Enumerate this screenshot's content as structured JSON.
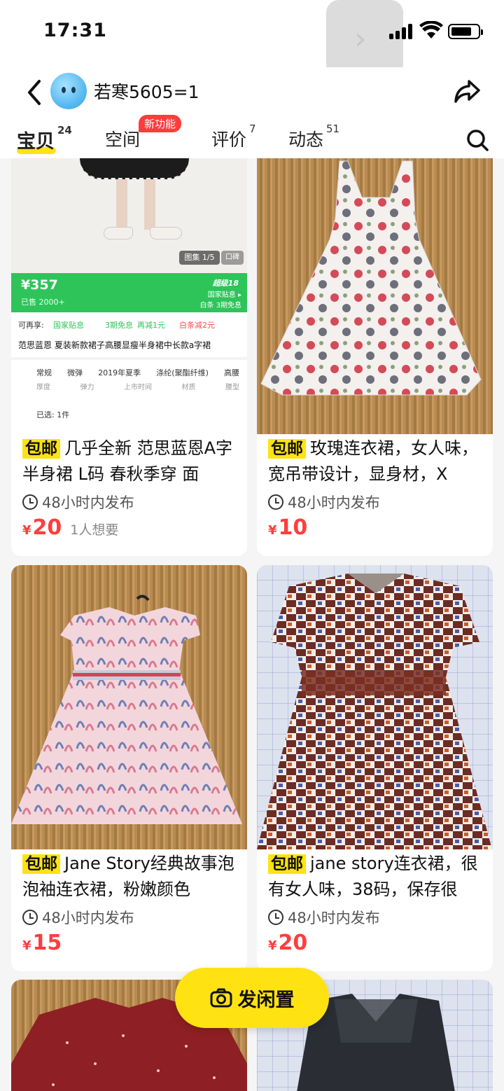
{
  "status_bar": {
    "time": "17:31"
  },
  "header": {
    "username": "若寒5605=1",
    "tabs": [
      {
        "label": "宝贝",
        "count": "24",
        "active": true
      },
      {
        "label": "空间",
        "badge": "新功能"
      },
      {
        "label": "评价",
        "count": "7"
      },
      {
        "label": "动态",
        "count": "51"
      }
    ]
  },
  "items": [
    {
      "shipping": "包邮",
      "title": "几乎全新 范思蓝恩A字半身裙 L码 春秋季穿 面",
      "time": "48小时内发布",
      "currency": "¥",
      "price": "20",
      "wants": "1人想要",
      "screenshot": {
        "gallery": "图集 1/5",
        "reviews": "口碑",
        "price": "¥357",
        "sold": "已售 2000+",
        "promo1": "超级18",
        "promo2": "国家贴息 ▸",
        "promo3": "白条 3期免息",
        "enjoy": "可再享:",
        "tag1": "国家贴息",
        "tag2": "3期免息",
        "tag3": "再减1元",
        "tag4": "白条减2元",
        "product": "范思蓝恩 夏装新款裙子高腰显瘦半身裙中长款a字裙",
        "attrs": [
          "常规",
          "微弹",
          "2019年夏季",
          "涤纶(聚酯纤维)",
          "高腰"
        ],
        "attr_names": [
          "厚度",
          "弹力",
          "上市时间",
          "材质",
          "腰型"
        ],
        "selected": "已选: 1件"
      }
    },
    {
      "shipping": "包邮",
      "title": "玫瑰连衣裙，女人味，宽吊带设计，显身材，X",
      "time": "48小时内发布",
      "currency": "¥",
      "price": "10"
    },
    {
      "shipping": "包邮",
      "title": "Jane Story经典故事泡泡袖连衣裙，粉嫩颜色",
      "time": "48小时内发布",
      "currency": "¥",
      "price": "15"
    },
    {
      "shipping": "包邮",
      "title": "jane story连衣裙，很有女人味，38码，保存很",
      "time": "48小时内发布",
      "currency": "¥",
      "price": "20"
    }
  ],
  "fab": {
    "label": "发闲置"
  },
  "colors": {
    "accent": "#ffe212",
    "price": "#ff3d3d",
    "green": "#2ec45a"
  }
}
